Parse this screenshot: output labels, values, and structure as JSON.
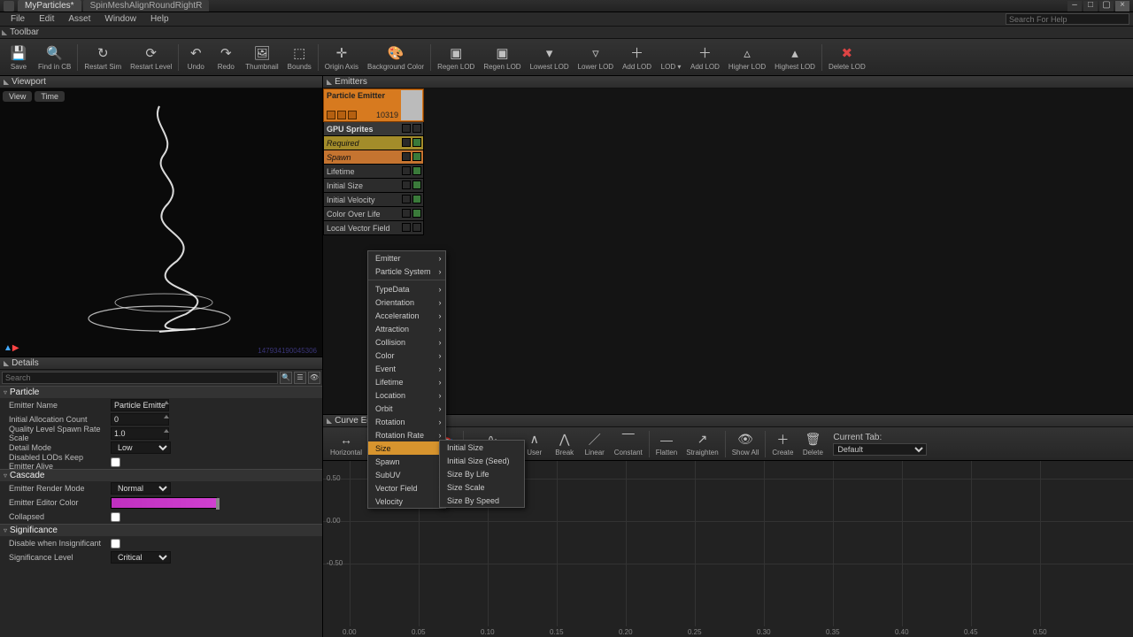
{
  "tabs": [
    "MyParticles*",
    "SpinMeshAlignRoundRightR"
  ],
  "menu": [
    "File",
    "Edit",
    "Asset",
    "Window",
    "Help"
  ],
  "search_placeholder": "Search For Help",
  "toolbar_label": "Toolbar",
  "toolbar": [
    {
      "label": "Save",
      "icon": "💾"
    },
    {
      "label": "Find in CB",
      "icon": "🔍"
    },
    {
      "label": "Restart Sim",
      "icon": "↻"
    },
    {
      "label": "Restart Level",
      "icon": "⟳"
    },
    {
      "label": "Undo",
      "icon": "↶"
    },
    {
      "label": "Redo",
      "icon": "↷"
    },
    {
      "label": "Thumbnail",
      "icon": "🖼"
    },
    {
      "label": "Bounds",
      "icon": "⬚"
    },
    {
      "label": "Origin Axis",
      "icon": "✛"
    },
    {
      "label": "Background Color",
      "icon": "🎨"
    },
    {
      "label": "Regen LOD",
      "icon": "▣"
    },
    {
      "label": "Regen LOD",
      "icon": "▣"
    },
    {
      "label": "Lowest LOD",
      "icon": "▾"
    },
    {
      "label": "Lower LOD",
      "icon": "▿"
    },
    {
      "label": "Add LOD",
      "icon": "＋"
    },
    {
      "label": "LOD ▾",
      "icon": ""
    },
    {
      "label": "Add LOD",
      "icon": "＋"
    },
    {
      "label": "Higher LOD",
      "icon": "▵"
    },
    {
      "label": "Highest LOD",
      "icon": "▴"
    },
    {
      "label": "Delete LOD",
      "icon": "✖"
    }
  ],
  "viewport": {
    "title": "Viewport",
    "btns": [
      "View",
      "Time"
    ],
    "footer": "147934190045306"
  },
  "details": {
    "title": "Details",
    "search_placeholder": "Search",
    "sections": [
      {
        "name": "Particle",
        "rows": [
          {
            "k": "Emitter Name",
            "type": "text",
            "v": "Particle Emitter"
          },
          {
            "k": "Initial Allocation Count",
            "type": "spin",
            "v": "0"
          },
          {
            "k": "Quality Level Spawn Rate Scale",
            "type": "spin",
            "v": "1.0"
          },
          {
            "k": "Detail Mode",
            "type": "select",
            "v": "Low"
          },
          {
            "k": "Disabled LODs Keep Emitter Alive",
            "type": "check",
            "v": false
          }
        ]
      },
      {
        "name": "Cascade",
        "rows": [
          {
            "k": "Emitter Render Mode",
            "type": "select",
            "v": "Normal"
          },
          {
            "k": "Emitter Editor Color",
            "type": "color",
            "v": "#d040d0"
          },
          {
            "k": "Collapsed",
            "type": "check",
            "v": false
          }
        ]
      },
      {
        "name": "Significance",
        "rows": [
          {
            "k": "Disable when Insignificant",
            "type": "check",
            "v": false
          },
          {
            "k": "Significance Level",
            "type": "select",
            "v": "Critical"
          }
        ]
      }
    ]
  },
  "emitters": {
    "title": "Emitters",
    "emitter_name": "Particle Emitter",
    "count": "10319",
    "modules": [
      {
        "n": "GPU Sprites",
        "cls": "dark"
      },
      {
        "n": "Required",
        "cls": "req",
        "c": true
      },
      {
        "n": "Spawn",
        "cls": "spw",
        "c": true
      },
      {
        "n": "Lifetime",
        "c": true
      },
      {
        "n": "Initial Size",
        "c": true
      },
      {
        "n": "Initial Velocity",
        "c": true
      },
      {
        "n": "Color Over Life",
        "c": true
      },
      {
        "n": "Local Vector Field"
      }
    ]
  },
  "ctx_main": [
    {
      "t": "Emitter",
      "s": 1
    },
    {
      "t": "Particle System",
      "s": 1
    },
    {
      "sep": 1
    },
    {
      "t": "TypeData",
      "s": 1
    },
    {
      "t": "Orientation",
      "s": 1
    },
    {
      "t": "Acceleration",
      "s": 1
    },
    {
      "t": "Attraction",
      "s": 1
    },
    {
      "t": "Collision",
      "s": 1
    },
    {
      "t": "Color",
      "s": 1
    },
    {
      "t": "Event",
      "s": 1
    },
    {
      "t": "Lifetime",
      "s": 1
    },
    {
      "t": "Location",
      "s": 1
    },
    {
      "t": "Orbit",
      "s": 1
    },
    {
      "t": "Rotation",
      "s": 1
    },
    {
      "t": "Rotation Rate",
      "s": 1
    },
    {
      "t": "Size",
      "s": 1,
      "hl": 1
    },
    {
      "t": "Spawn",
      "s": 1
    },
    {
      "t": "SubUV",
      "s": 1
    },
    {
      "t": "Vector Field",
      "s": 1
    },
    {
      "t": "Velocity",
      "s": 1
    }
  ],
  "ctx_sub": [
    "Initial Size",
    "Initial Size (Seed)",
    "Size By Life",
    "Size Scale",
    "Size By Speed"
  ],
  "curve": {
    "title": "Curve Ed",
    "tools": [
      {
        "l": "Horizontal",
        "i": "↔"
      },
      {
        "l": "",
        "i": "⊕"
      },
      {
        "l": "",
        "i": "⊙"
      },
      {
        "l": "",
        "i": "🎯"
      },
      {
        "l": "Auto/Clamped",
        "i": "∿"
      },
      {
        "l": "User",
        "i": "∧"
      },
      {
        "l": "Break",
        "i": "⋀"
      },
      {
        "l": "Linear",
        "i": "／"
      },
      {
        "l": "Constant",
        "i": "⎺"
      },
      {
        "l": "Flatten",
        "i": "—"
      },
      {
        "l": "Straighten",
        "i": "↗"
      },
      {
        "l": "Show All",
        "i": "👁"
      },
      {
        "l": "Create",
        "i": "＋"
      },
      {
        "l": "Delete",
        "i": "🗑"
      }
    ],
    "tab_label": "Current Tab:",
    "tab_value": "Default",
    "ylabels": [
      "0.50",
      "0.00",
      "-0.50"
    ],
    "xlabels": [
      "0.00",
      "0.05",
      "0.10",
      "0.15",
      "0.20",
      "0.25",
      "0.30",
      "0.35",
      "0.40",
      "0.45",
      "0.50"
    ]
  }
}
